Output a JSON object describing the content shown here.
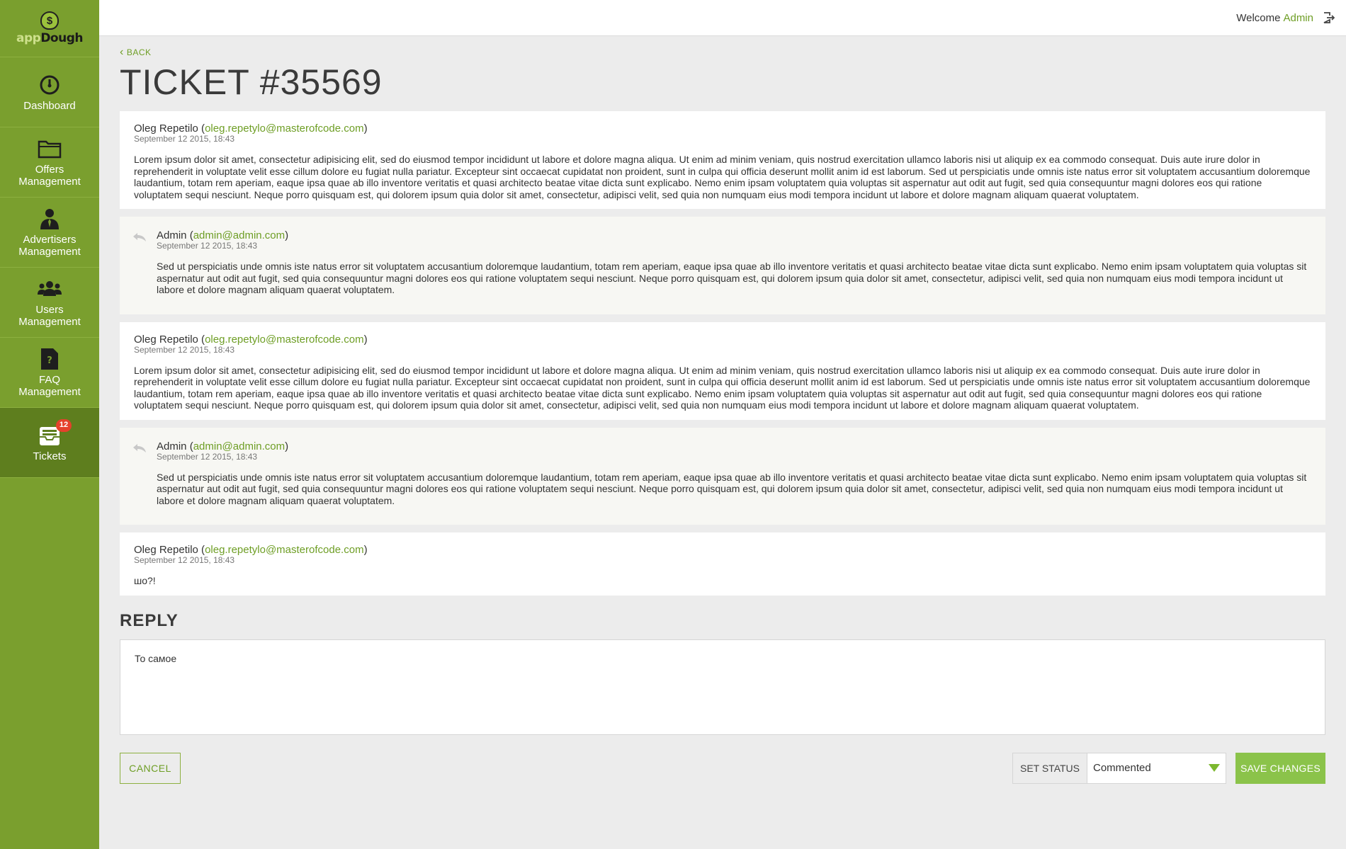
{
  "brand": {
    "logo_symbol": "$",
    "logo_prefix": "app",
    "logo_suffix": "Dough"
  },
  "topbar": {
    "welcome": "Welcome",
    "user": "Admin"
  },
  "sidebar": {
    "items": [
      {
        "label": "Dashboard",
        "icon": "dashboard-gauge-icon"
      },
      {
        "label": "Offers\nManagement",
        "icon": "folder-icon"
      },
      {
        "label": "Advertisers\nManagement",
        "icon": "advertiser-icon"
      },
      {
        "label": "Users\nManagement",
        "icon": "users-icon"
      },
      {
        "label": "FAQ\nManagement",
        "icon": "faq-document-icon"
      },
      {
        "label": "Tickets",
        "icon": "tickets-inbox-icon",
        "badge": "12",
        "active": true
      }
    ]
  },
  "page": {
    "back": "BACK",
    "title": "TICKET #35569"
  },
  "messages": [
    {
      "author": "Oleg Repetilo",
      "email": "oleg.repetylo@masterofcode.com",
      "date": "September 12 2015, 18:43",
      "body": "Lorem ipsum dolor sit amet, consectetur adipisicing elit, sed do eiusmod tempor incididunt ut labore et dolore magna aliqua. Ut enim ad minim veniam, quis nostrud exercitation ullamco laboris nisi ut aliquip ex ea commodo consequat. Duis aute irure dolor in reprehenderit in voluptate velit esse cillum dolore eu fugiat nulla pariatur. Excepteur sint occaecat cupidatat non proident, sunt in culpa qui officia deserunt mollit anim id est laborum. Sed ut perspiciatis unde omnis iste natus error sit voluptatem accusantium doloremque laudantium, totam rem aperiam, eaque ipsa quae ab illo inventore veritatis et quasi architecto beatae vitae dicta sunt explicabo. Nemo enim ipsam voluptatem quia voluptas sit aspernatur aut odit aut fugit, sed quia consequuntur magni dolores eos qui ratione voluptatem sequi nesciunt. Neque porro quisquam est, qui dolorem ipsum quia dolor sit amet, consectetur, adipisci velit, sed quia non numquam eius modi tempora incidunt ut labore et dolore magnam aliquam quaerat voluptatem."
    },
    {
      "author": "Admin",
      "email": "admin@admin.com",
      "date": "September 12 2015, 18:43",
      "body": "Sed ut perspiciatis unde omnis iste natus error sit voluptatem accusantium doloremque laudantium, totam rem aperiam, eaque ipsa quae ab illo inventore veritatis et quasi architecto beatae vitae dicta sunt explicabo. Nemo enim ipsam voluptatem quia voluptas sit aspernatur aut odit aut fugit, sed quia consequuntur magni dolores eos qui ratione voluptatem sequi nesciunt. Neque porro quisquam est, qui dolorem ipsum quia dolor sit amet, consectetur, adipisci velit, sed quia non numquam eius modi tempora incidunt ut labore et dolore magnam aliquam quaerat voluptatem."
    },
    {
      "author": "Oleg Repetilo",
      "email": "oleg.repetylo@masterofcode.com",
      "date": "September 12 2015, 18:43",
      "body": "Lorem ipsum dolor sit amet, consectetur adipisicing elit, sed do eiusmod tempor incididunt ut labore et dolore magna aliqua. Ut enim ad minim veniam, quis nostrud exercitation ullamco laboris nisi ut aliquip ex ea commodo consequat. Duis aute irure dolor in reprehenderit in voluptate velit esse cillum dolore eu fugiat nulla pariatur. Excepteur sint occaecat cupidatat non proident, sunt in culpa qui officia deserunt mollit anim id est laborum. Sed ut perspiciatis unde omnis iste natus error sit voluptatem accusantium doloremque laudantium, totam rem aperiam, eaque ipsa quae ab illo inventore veritatis et quasi architecto beatae vitae dicta sunt explicabo. Nemo enim ipsam voluptatem quia voluptas sit aspernatur aut odit aut fugit, sed quia consequuntur magni dolores eos qui ratione voluptatem sequi nesciunt. Neque porro quisquam est, qui dolorem ipsum quia dolor sit amet, consectetur, adipisci velit, sed quia non numquam eius modi tempora incidunt ut labore et dolore magnam aliquam quaerat voluptatem."
    },
    {
      "author": "Admin",
      "email": "admin@admin.com",
      "date": "September 12 2015, 18:43",
      "body": "Sed ut perspiciatis unde omnis iste natus error sit voluptatem accusantium doloremque laudantium, totam rem aperiam, eaque ipsa quae ab illo inventore veritatis et quasi architecto beatae vitae dicta sunt explicabo. Nemo enim ipsam voluptatem quia voluptas sit aspernatur aut odit aut fugit, sed quia consequuntur magni dolores eos qui ratione voluptatem sequi nesciunt. Neque porro quisquam est, qui dolorem ipsum quia dolor sit amet, consectetur, adipisci velit, sed quia non numquam eius modi tempora incidunt ut labore et dolore magnam aliquam quaerat voluptatem."
    },
    {
      "author": "Oleg Repetilo",
      "email": "oleg.repetylo@masterofcode.com",
      "date": "September 12 2015, 18:43",
      "body": "шо?!"
    }
  ],
  "reply": {
    "heading": "REPLY",
    "value": "То самое"
  },
  "actions": {
    "cancel": "CANCEL",
    "set_status": "SET STATUS",
    "status_value": "Commented",
    "save": "SAVE CHANGES"
  },
  "colors": {
    "sidebar": "#7a9f2e",
    "sidebar_active": "#5e7e1e",
    "accent": "#6e9e25",
    "save_button": "#8bc34a",
    "badge": "#e5412c"
  }
}
